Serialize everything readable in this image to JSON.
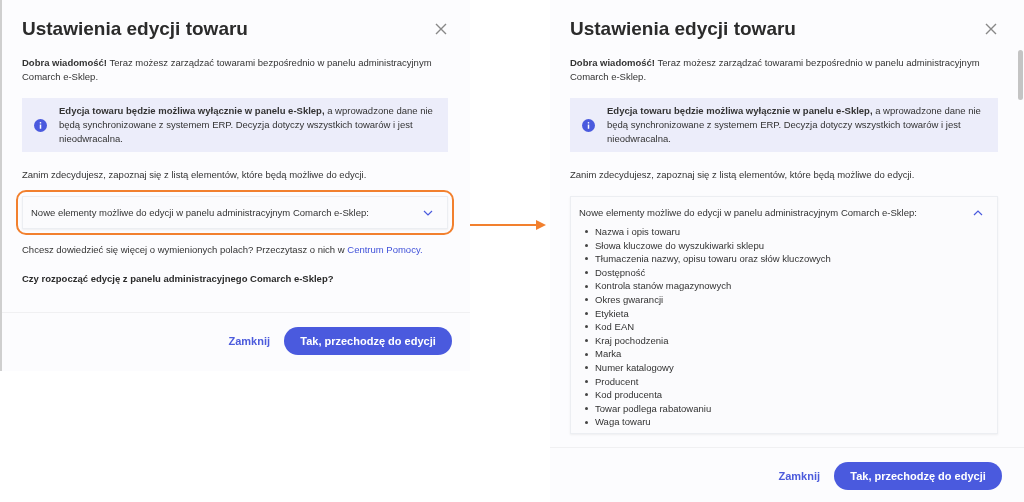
{
  "dialogs": [
    {
      "title": "Ustawienia edycji towaru",
      "intro": "**Dobra wiadomość!** Teraz możesz zarządzać towarami bezpośrednio w panelu administracyjnym Comarch e-Sklep.",
      "info": "**Edycja towaru będzie możliwa wyłącznie w panelu e-Sklep,** a wprowadzone dane nie będą synchronizowane z systemem ERP. Decyzja dotyczy wszystkich towarów i jest nieodwracalna.",
      "lead": "Zanim zdecydujesz, zapoznaj się z listą elementów, które będą możliwe do edycji.",
      "accordion": {
        "title": "Nowe elementy możliwe do edycji w panelu administracyjnym Comarch e-Sklep:",
        "expanded": false,
        "highlighted": true
      },
      "help": {
        "text": "Chcesz dowiedzieć się więcej o wymienionych polach? Przeczytasz o nich w ",
        "link": "Centrum Pomocy."
      },
      "question": "Czy rozpocząć edycję z panelu administracyjnego Comarch e-Sklep?",
      "buttons": {
        "secondary": "Zamknij",
        "primary": "Tak, przechodzę do edycji"
      }
    },
    {
      "title": "Ustawienia edycji towaru",
      "intro": "**Dobra wiadomość!** Teraz możesz zarządzać towarami bezpośrednio w panelu administracyjnym Comarch e-Sklep.",
      "info": "**Edycja towaru będzie możliwa wyłącznie w panelu e-Sklep,** a wprowadzone dane nie będą synchronizowane z systemem ERP. Decyzja dotyczy wszystkich towarów i jest nieodwracalna.",
      "lead": "Zanim zdecydujesz, zapoznaj się z listą elementów, które będą możliwe do edycji.",
      "accordion": {
        "title": "Nowe elementy możliwe do edycji w panelu administracyjnym Comarch e-Sklep:",
        "expanded": true,
        "highlighted": false,
        "items": [
          "Nazwa i opis towaru",
          "Słowa kluczowe do wyszukiwarki sklepu",
          "Tłumaczenia nazwy, opisu towaru oraz słów kluczowych",
          "Dostępność",
          "Kontrola stanów magazynowych",
          "Okres gwarancji",
          "Etykieta",
          "Kod EAN",
          "Kraj pochodzenia",
          "Marka",
          "Numer katalogowy",
          "Producent",
          "Kod producenta",
          "Towar podlega rabatowaniu",
          "Waga towaru"
        ]
      },
      "buttons": {
        "secondary": "Zamknij",
        "primary": "Tak, przechodzę do edycji"
      }
    }
  ]
}
